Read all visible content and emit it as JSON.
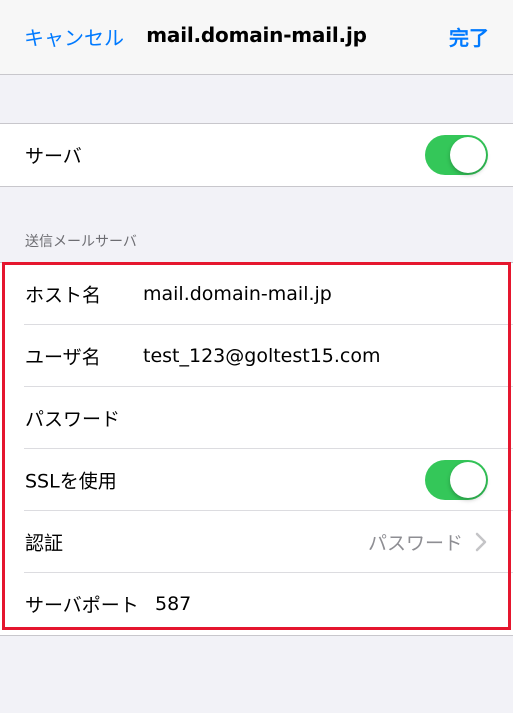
{
  "nav": {
    "cancel_label": "キャンセル",
    "title": "mail.domain-mail.jp",
    "done_label": "完了"
  },
  "server_group": {
    "label": "サーバ",
    "enabled": true
  },
  "outgoing": {
    "header": "送信メールサーバ",
    "host": {
      "label": "ホスト名",
      "value": "mail.domain-mail.jp"
    },
    "user": {
      "label": "ユーザ名",
      "value": "test_123@goltest15.com"
    },
    "password": {
      "label": "パスワード",
      "value": ""
    },
    "ssl": {
      "label": "SSLを使用",
      "enabled": true
    },
    "auth": {
      "label": "認証",
      "value": "パスワード"
    },
    "port": {
      "label": "サーバポート",
      "value": "587"
    }
  },
  "colors": {
    "accent": "#007aff",
    "toggle_on": "#34c759",
    "highlight": "#e5162e",
    "background": "#f2f2f7"
  },
  "icons": [
    "chevron-right-icon"
  ]
}
